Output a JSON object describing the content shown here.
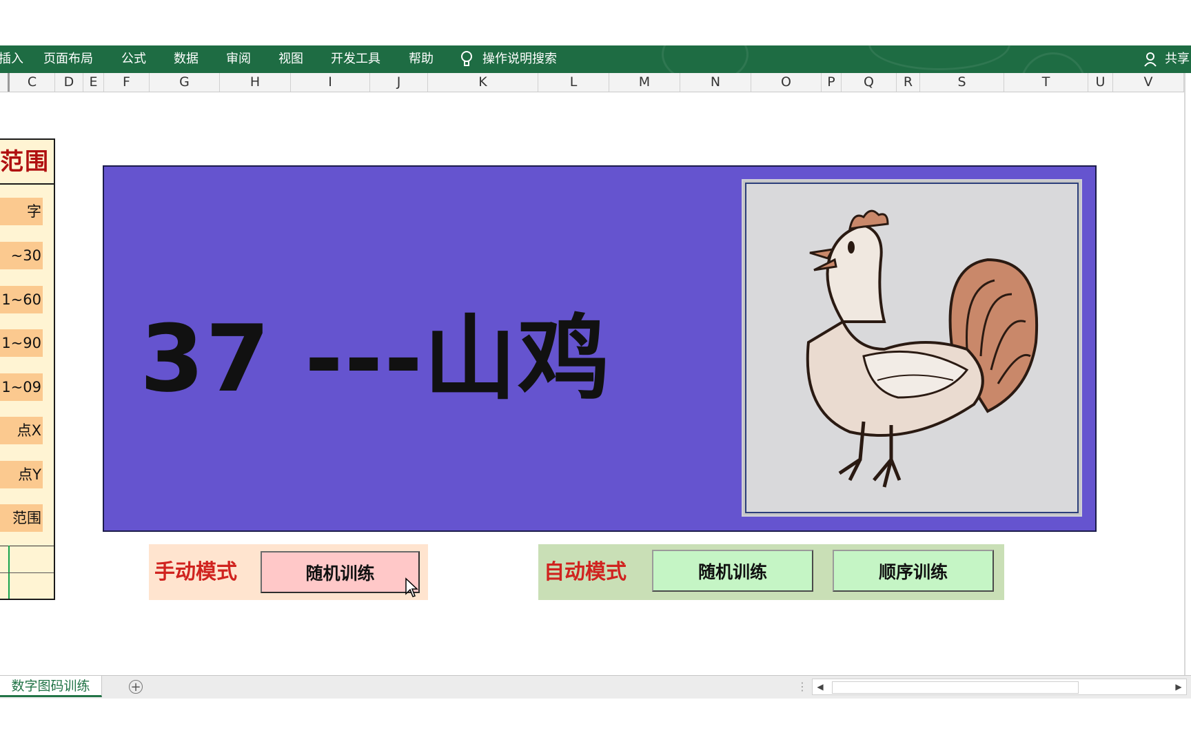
{
  "menu": {
    "items": [
      "插入",
      "页面布局",
      "公式",
      "数据",
      "审阅",
      "视图",
      "开发工具",
      "帮助"
    ],
    "search_label": "操作说明搜索",
    "share_label": "共享"
  },
  "columns": [
    "C",
    "D",
    "E",
    "F",
    "G",
    "H",
    "I",
    "J",
    "K",
    "L",
    "M",
    "N",
    "O",
    "P",
    "Q",
    "R",
    "S",
    "T",
    "U",
    "V"
  ],
  "left_panel": {
    "title": "范围",
    "items": [
      "字",
      "~30",
      "1~60",
      "1~90",
      "1~09",
      "点X",
      "点Y",
      "范围"
    ]
  },
  "banner": {
    "text": "37 ---山鸡",
    "background": "#6554cf"
  },
  "manual_mode": {
    "label": "手动模式",
    "random_button": "随机训练"
  },
  "auto_mode": {
    "label": "自动模式",
    "random_button": "随机训练",
    "sequential_button": "顺序训练"
  },
  "sheet_tabs": {
    "active_tab": "数字图码训练",
    "add_symbol": "+"
  },
  "colors": {
    "ribbon": "#1e6c43",
    "accent_red": "#d0231f",
    "manual_bg": "#ffe4cf",
    "auto_bg": "#c9dfb6"
  }
}
